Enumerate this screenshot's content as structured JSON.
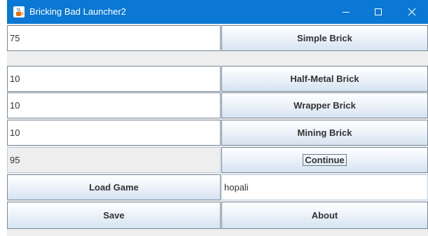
{
  "window": {
    "title": "Bricking Bad Launcher2"
  },
  "fields": {
    "simple_count": "75",
    "half_metal_count": "10",
    "wrapper_count": "10",
    "mining_count": "10",
    "total_count": "95",
    "player_name": "hopali"
  },
  "buttons": {
    "simple_brick": "Simple Brick",
    "half_metal_brick": "Half-Metal Brick",
    "wrapper_brick": "Wrapper Brick",
    "mining_brick": "Mining Brick",
    "continue": "Continue",
    "load_game": "Load Game",
    "save": "Save",
    "about": "About"
  },
  "icons": {
    "app": "java-cup-icon",
    "minimize": "minimize-icon",
    "maximize": "maximize-icon",
    "close": "close-icon"
  },
  "colors": {
    "titlebar": "#0a78d4",
    "button_gradient_top": "#ffffff",
    "button_gradient_bottom": "#d6e3f1",
    "border": "#7a8a99"
  }
}
